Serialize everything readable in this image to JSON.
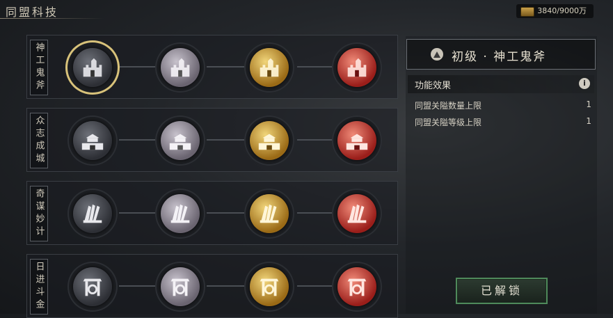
{
  "header": {
    "title": "同盟科技",
    "resource_text": "3840/9000万",
    "resource_icon": "gold-bar-icon"
  },
  "tech_rows": [
    {
      "label": "神工鬼斧",
      "icon": "fortress-icon",
      "selected_index": 0
    },
    {
      "label": "众志成城",
      "icon": "city-wall-icon",
      "selected_index": null
    },
    {
      "label": "奇谋妙计",
      "icon": "scroll-fan-icon",
      "selected_index": null
    },
    {
      "label": "日进斗金",
      "icon": "gate-coin-icon",
      "selected_index": null
    }
  ],
  "node_tiers": [
    "dark",
    "silver",
    "gold",
    "red"
  ],
  "detail": {
    "title": "初级 · 神工鬼斧",
    "effect_header": "功能效果",
    "effects": [
      {
        "label": "同盟关隘数量上限",
        "value": "1"
      },
      {
        "label": "同盟关隘等级上限",
        "value": "1"
      }
    ],
    "button_label": "已解锁"
  },
  "colors": {
    "selected_ring": "#d8c27a",
    "unlock_border": "#4f8a5b"
  }
}
